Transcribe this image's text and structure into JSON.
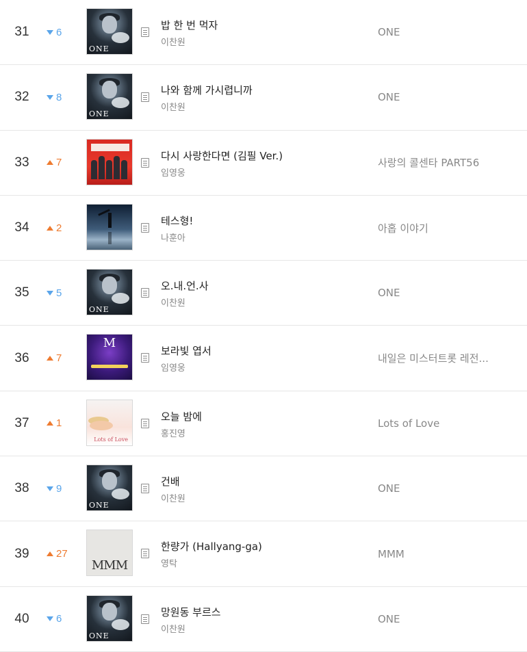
{
  "chart": {
    "rows": [
      {
        "rank": "31",
        "change_dir": "down",
        "change": "6",
        "title": "밥 한 번 먹자",
        "artist": "이찬원",
        "album": "ONE",
        "cover": "one",
        "cover_text": "ONE"
      },
      {
        "rank": "32",
        "change_dir": "down",
        "change": "8",
        "title": "나와 함께 가시렵니까",
        "artist": "이찬원",
        "album": "ONE",
        "cover": "one",
        "cover_text": "ONE"
      },
      {
        "rank": "33",
        "change_dir": "up",
        "change": "7",
        "title": "다시 사랑한다면 (김필 Ver.)",
        "artist": "임영웅",
        "album": "사랑의 콜센타 PART56",
        "cover": "call",
        "cover_text": ""
      },
      {
        "rank": "34",
        "change_dir": "up",
        "change": "2",
        "title": "테스형!",
        "artist": "나훈아",
        "album": "아홉 이야기",
        "cover": "night",
        "cover_text": ""
      },
      {
        "rank": "35",
        "change_dir": "down",
        "change": "5",
        "title": "오.내.언.사",
        "artist": "이찬원",
        "album": "ONE",
        "cover": "one",
        "cover_text": "ONE"
      },
      {
        "rank": "36",
        "change_dir": "up",
        "change": "7",
        "title": "보라빛 엽서",
        "artist": "임영웅",
        "album": "내일은 미스터트롯 레전...",
        "cover": "m",
        "cover_text": "M"
      },
      {
        "rank": "37",
        "change_dir": "up",
        "change": "1",
        "title": "오늘 밤에",
        "artist": "홍진영",
        "album": "Lots of Love",
        "cover": "love",
        "cover_text": "Lots of Love"
      },
      {
        "rank": "38",
        "change_dir": "down",
        "change": "9",
        "title": "건배",
        "artist": "이찬원",
        "album": "ONE",
        "cover": "one",
        "cover_text": "ONE"
      },
      {
        "rank": "39",
        "change_dir": "up",
        "change": "27",
        "title": "한량가 (Hallyang-ga)",
        "artist": "영탁",
        "album": "MMM",
        "cover": "mmm",
        "cover_text": "MMM"
      },
      {
        "rank": "40",
        "change_dir": "down",
        "change": "6",
        "title": "망원동 부르스",
        "artist": "이찬원",
        "album": "ONE",
        "cover": "one",
        "cover_text": "ONE"
      }
    ]
  },
  "colors": {
    "up": "#ee7b30",
    "down": "#5aa5ea"
  },
  "icons": {
    "up": "triangle-up-icon",
    "down": "triangle-down-icon",
    "lyrics": "lyrics-document-icon"
  }
}
